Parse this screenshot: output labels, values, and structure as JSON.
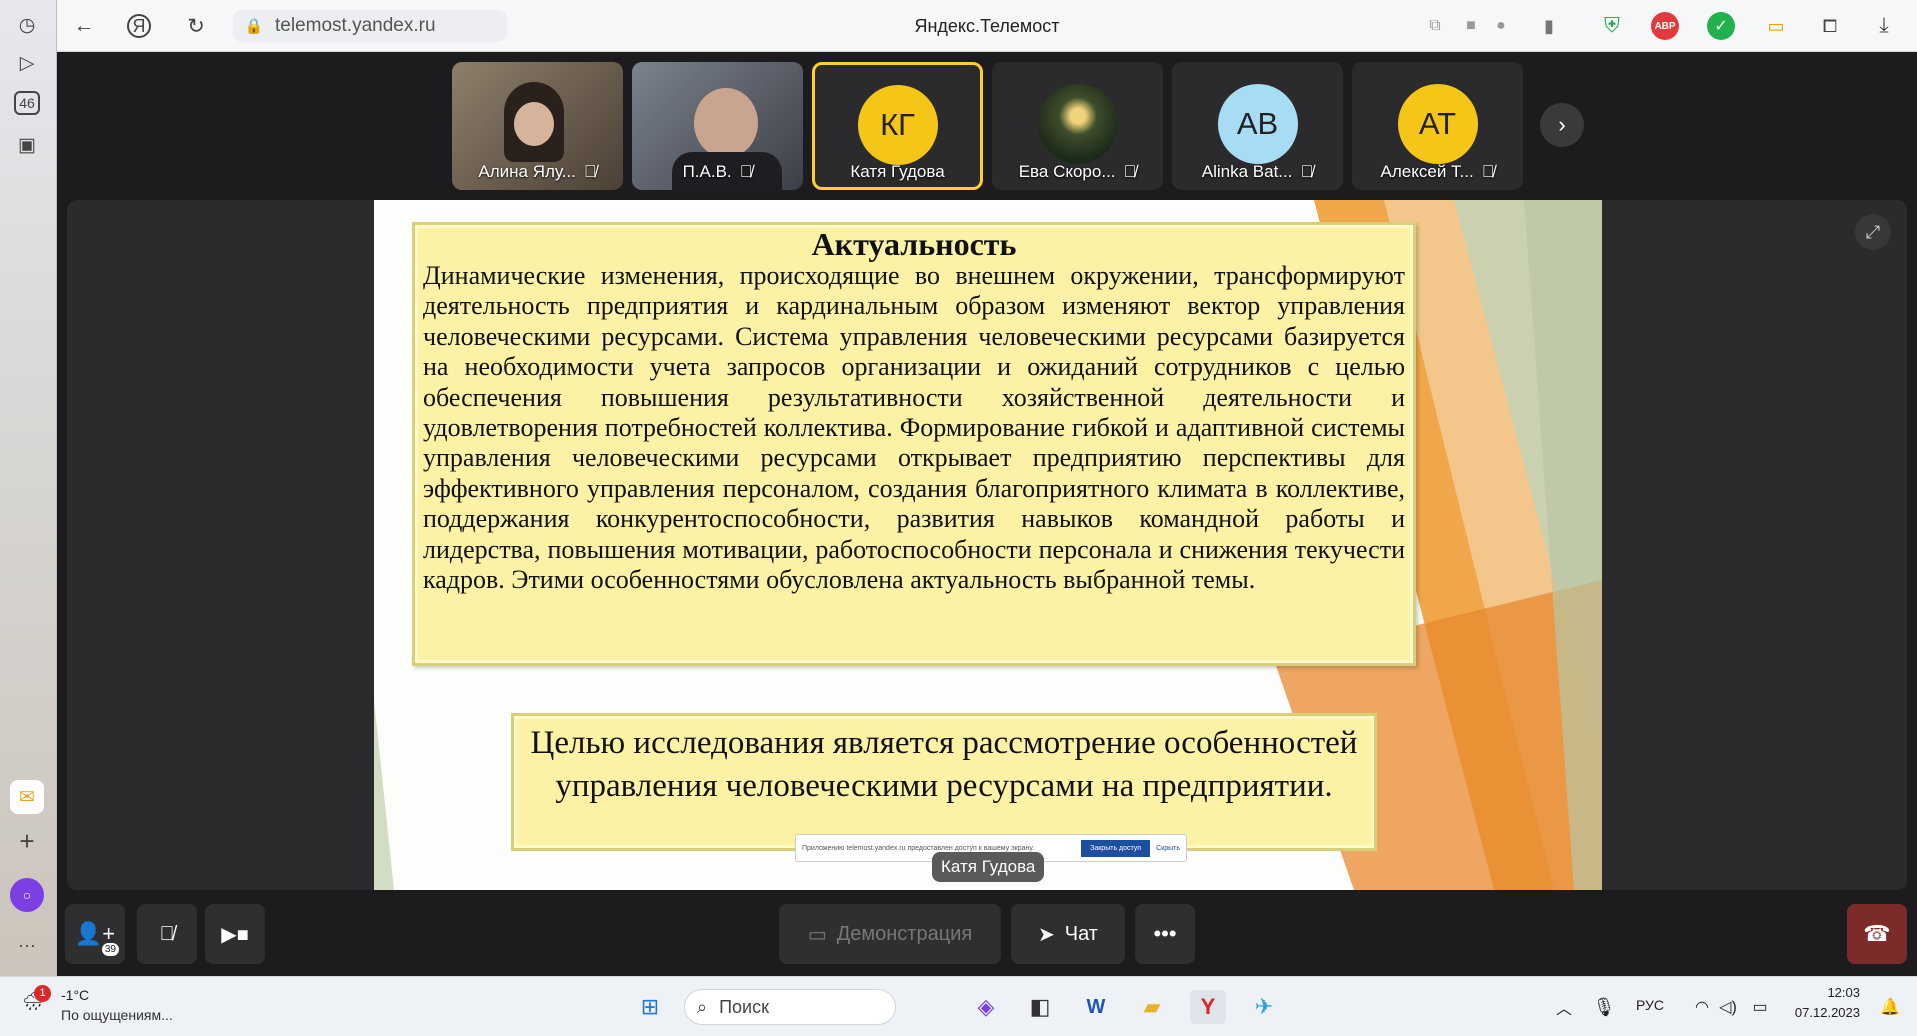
{
  "browser": {
    "url": "telemost.yandex.ru",
    "page_title": "Яндекс.Телемост",
    "sidebar_badge": "46",
    "ext_abp": "ABP"
  },
  "participants": [
    {
      "name": "Алина Ялу...",
      "initials": "",
      "type": "video",
      "muted": true
    },
    {
      "name": "П.А.В.",
      "initials": "",
      "type": "video",
      "muted": true
    },
    {
      "name": "Катя Гудова",
      "initials": "КГ",
      "type": "avatar",
      "color": "#f5c518",
      "muted": false,
      "selected": true
    },
    {
      "name": "Ева Скоро...",
      "initials": "",
      "type": "photo",
      "muted": true
    },
    {
      "name": "Alinka Bat...",
      "initials": "AB",
      "type": "avatar",
      "color": "#a8dcf5",
      "muted": true
    },
    {
      "name": "Алексей Т...",
      "initials": "АТ",
      "type": "avatar",
      "color": "#f5c518",
      "muted": true
    }
  ],
  "slide": {
    "heading": "Актуальность",
    "body": "Динамические изменения, происходящие во внешнем окружении, трансформируют деятельность предприятия и кардинальным образом изменяют вектор управления человеческими ресурсами. Система управления человеческими ресурсами базируется на необходимости учета запросов организации и ожиданий сотрудников с целью обеспечения повышения результативности хозяйственной деятельности и удовлетворения потребностей коллектива. Формирование гибкой и адаптивной системы управления человеческими ресурсами открывает предприятию перспективы для эффективного управления персоналом, создания благоприятного климата в коллективе, поддержания конкурентоспособности, развития навыков командной работы и лидерства, повышения мотивации, работоспособности персонала и снижения текучести кадров. Этими особенностями обусловлена актуальность выбранной темы.",
    "goal": "Целью исследования является рассмотрение особенностей управления человеческими ресурсами на предприятии.",
    "notice_text": "Приложению telemost.yandex.ru предоставлен доступ к вашему экрану.",
    "notice_button": "Закрыть доступ",
    "notice_hide": "Скрыть"
  },
  "speaker_label": "Катя Гудова",
  "controls": {
    "participants_count": "39",
    "demo_label": "Демонстрация",
    "chat_label": "Чат"
  },
  "taskbar": {
    "weather_temp": "-1°C",
    "weather_desc": "По ощущениям...",
    "weather_badge": "1",
    "search_placeholder": "Поиск",
    "lang": "РУС",
    "time": "12:03",
    "date": "07.12.2023"
  },
  "colors": {
    "accent": "#ffcc33",
    "hangup": "#7d2a2a"
  }
}
